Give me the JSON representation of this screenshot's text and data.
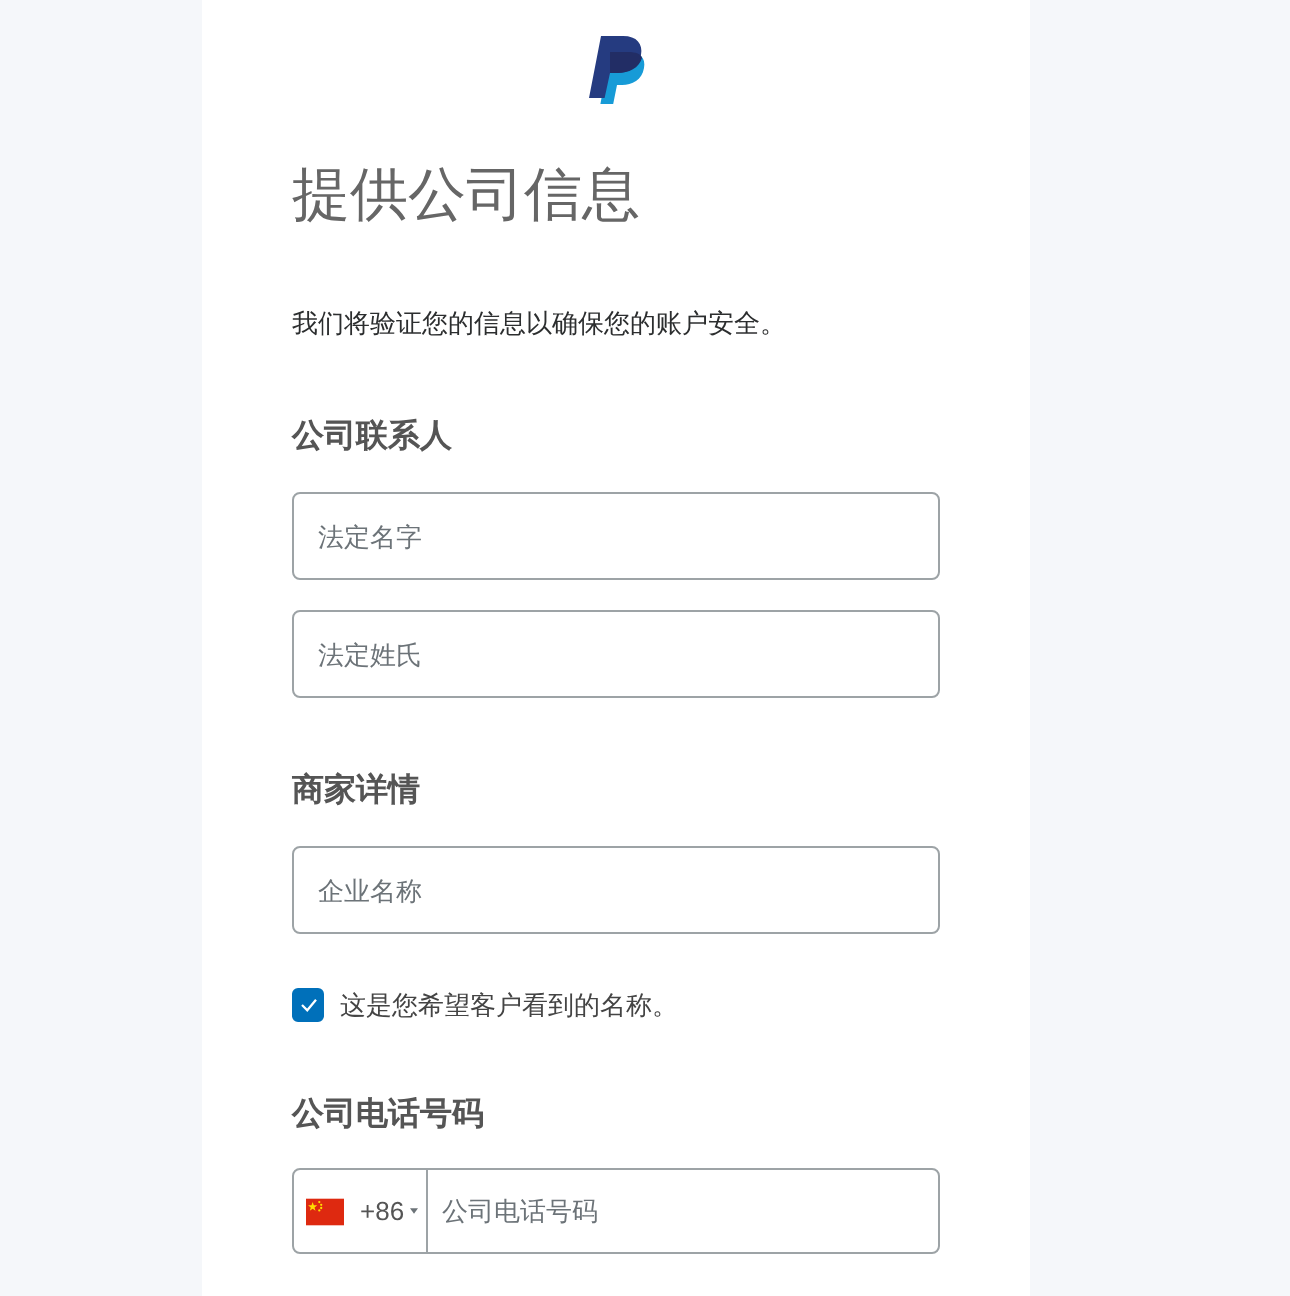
{
  "title": "提供公司信息",
  "intro": "我们将验证您的信息以确保您的账户安全。",
  "sections": [
    {
      "heading": "公司联系人",
      "items": [
        {
          "kind": "text",
          "placeholder": "法定名字"
        },
        {
          "kind": "text",
          "placeholder": "法定姓氏"
        }
      ]
    },
    {
      "heading": "商家详情",
      "items": [
        {
          "kind": "text",
          "placeholder": "企业名称"
        },
        {
          "kind": "checkbox",
          "label": "这是您希望客户看到的名称。",
          "checked": true
        }
      ]
    },
    {
      "heading": "公司电话号码",
      "items": [
        {
          "kind": "phone",
          "country_code": "+86",
          "placeholder": "公司电话号码"
        }
      ]
    }
  ]
}
